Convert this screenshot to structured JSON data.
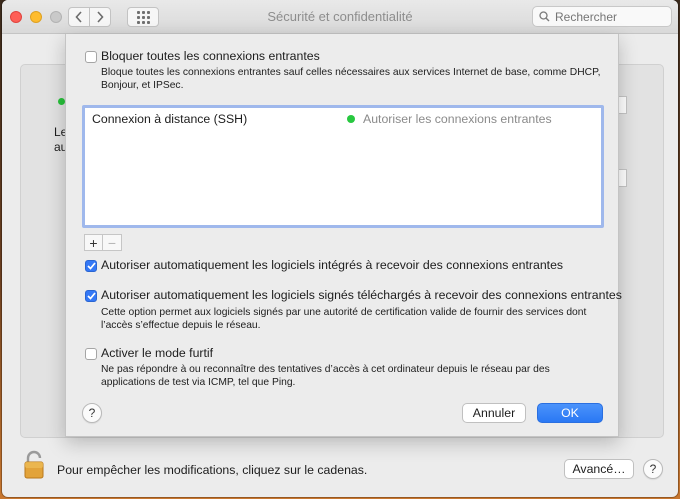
{
  "window": {
    "title": "Sécurité et confidentialité",
    "search_placeholder": "Rechercher"
  },
  "background": {
    "fragment_1": "Le",
    "fragment_2": "au"
  },
  "sheet": {
    "block_all": {
      "label": "Bloquer toutes les connexions entrantes",
      "checked": false,
      "description_line1": "Bloque toutes les connexions entrantes sauf celles nécessaires aux services Internet de base, comme DHCP,",
      "description_line2": "Bonjour, et IPSec."
    },
    "list": {
      "rows": [
        {
          "name": "Connexion à distance (SSH)",
          "status": "Autoriser les connexions entrantes",
          "status_color": "#28c840"
        }
      ]
    },
    "add_symbol": "+",
    "remove_symbol": "−",
    "auto_builtin": {
      "label": "Autoriser automatiquement les logiciels intégrés à recevoir des connexions entrantes",
      "checked": true
    },
    "auto_signed": {
      "label": "Autoriser automatiquement les logiciels signés téléchargés à recevoir des connexions entrantes",
      "checked": true,
      "description_line1": "Cette option permet aux logiciels signés par une autorité de certification valide de fournir des services dont",
      "description_line2": "l’accès s’effectue depuis le réseau."
    },
    "stealth": {
      "label": "Activer le mode furtif",
      "checked": false,
      "description_line1": "Ne pas répondre à ou reconnaître des tentatives d’accès à cet ordinateur depuis le réseau par des",
      "description_line2": "applications de test via ICMP, tel que Ping."
    },
    "help_symbol": "?",
    "cancel_label": "Annuler",
    "ok_label": "OK"
  },
  "footer": {
    "lock_text": "Pour empêcher les modifications, cliquez sur le cadenas.",
    "advanced_label": "Avancé…",
    "help_symbol": "?"
  },
  "colors": {
    "accent": "#3478f6",
    "green_status": "#28c840"
  }
}
